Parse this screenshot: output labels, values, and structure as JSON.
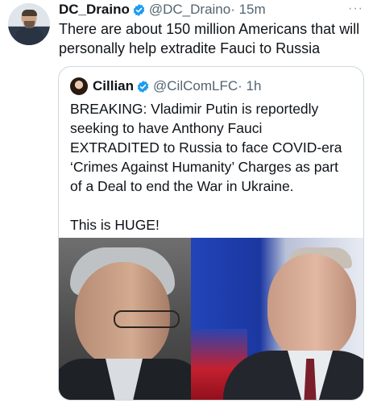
{
  "tweet": {
    "display_name": "DC_Draino",
    "handle": "@DC_Draino",
    "time": "· 15m",
    "text": "There are about 150 million Americans that will personally help extradite Fauci to Russia",
    "more_label": "···"
  },
  "quoted": {
    "display_name": "Cillian",
    "handle": "@CilComLFC",
    "time": "· 1h",
    "paragraph1": "BREAKING: Vladimir Putin is reportedly seeking to have Anthony Fauci EXTRADITED to Russia to face COVID-era ‘Crimes Against Humanity’ Charges as part of a Deal to end the War in Ukraine.",
    "paragraph2": "This is HUGE!"
  },
  "colors": {
    "verified_blue": "#1d9bf0",
    "text": "#0f1419",
    "muted": "#536471",
    "border": "#cfd9de"
  },
  "icons": {
    "verified": "verified-badge-icon",
    "more": "more-options-icon"
  }
}
